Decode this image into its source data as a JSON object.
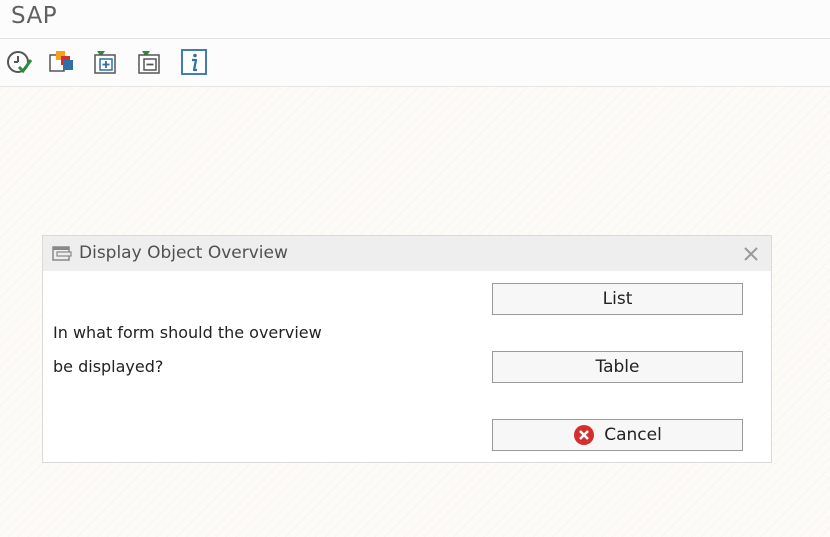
{
  "app": {
    "title": "SAP"
  },
  "toolbar": {
    "buttons": [
      {
        "name": "execute-check-icon"
      },
      {
        "name": "copy-objects-icon"
      },
      {
        "name": "expand-all-icon"
      },
      {
        "name": "collapse-all-icon"
      },
      {
        "name": "info-icon"
      }
    ]
  },
  "dialog": {
    "title": "Display Object Overview",
    "question_line1": "In what form should the overview",
    "question_line2": "be displayed?",
    "list_label": "List",
    "table_label": "Table",
    "cancel_label": "Cancel"
  },
  "colors": {
    "accent_green": "#2e8b3e",
    "accent_blue": "#2f6fa8",
    "cancel_red": "#d32f2f",
    "copy_orange": "#f5a21b"
  }
}
